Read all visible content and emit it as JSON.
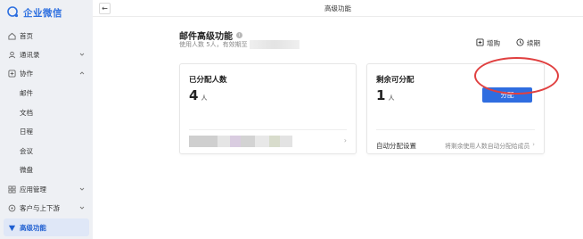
{
  "app": {
    "name": "企业微信"
  },
  "sidebar": {
    "items": [
      {
        "label": "首页",
        "icon": "home-icon"
      },
      {
        "label": "通讯录",
        "icon": "contacts-icon"
      },
      {
        "label": "协作",
        "icon": "collab-icon"
      },
      {
        "label": "邮件"
      },
      {
        "label": "文档"
      },
      {
        "label": "日程"
      },
      {
        "label": "会议"
      },
      {
        "label": "微盘"
      },
      {
        "label": "应用管理",
        "icon": "apps-icon"
      },
      {
        "label": "客户与上下游",
        "icon": "customer-icon"
      },
      {
        "label": "高级功能",
        "icon": "advanced-icon",
        "active": true
      }
    ]
  },
  "topbar": {
    "title": "高级功能",
    "back_symbol": "←"
  },
  "feature": {
    "title": "邮件高级功能",
    "info_symbol": "i",
    "subtitle": "使用人数 5人，有效期至",
    "buy_label": "增购",
    "renew_label": "续期"
  },
  "assigned_card": {
    "title": "已分配人数",
    "count": "4",
    "unit": "人",
    "arrow": "›"
  },
  "remaining_card": {
    "title": "剩余可分配",
    "count": "1",
    "unit": "人",
    "assign_label": "分配",
    "auto_label": "自动分配设置",
    "auto_desc": "将剩余使用人数自动分配给成员",
    "arrow": "›"
  },
  "colors": {
    "accent": "#2f6de0",
    "brand": "#2d6fe0",
    "highlight": "#e04040",
    "active_bg": "#dfe7f7"
  }
}
